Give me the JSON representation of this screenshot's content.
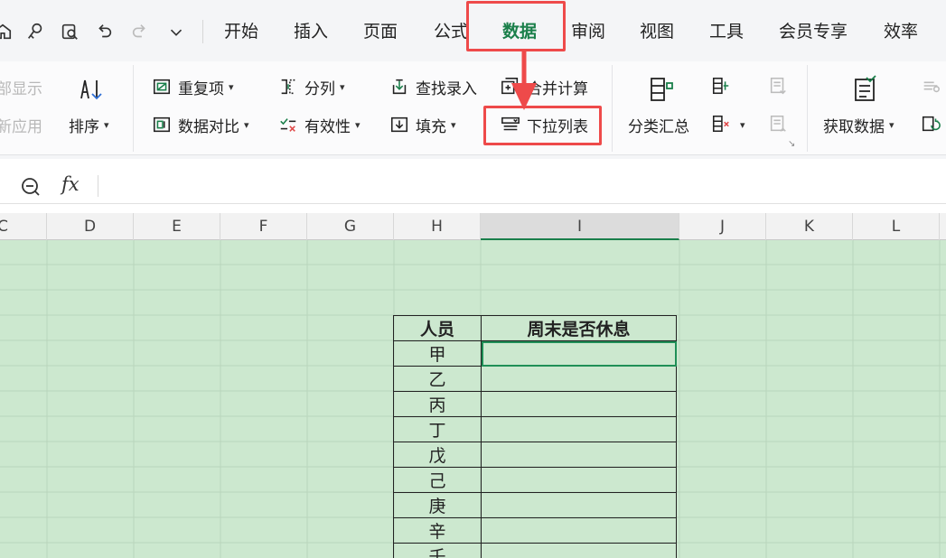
{
  "quick_access": [
    "home-icon",
    "brush-icon",
    "print-preview-icon",
    "undo-icon",
    "redo-icon",
    "chevron-down-icon"
  ],
  "tabs": [
    {
      "label": "开始",
      "active": false
    },
    {
      "label": "插入",
      "active": false
    },
    {
      "label": "页面",
      "active": false
    },
    {
      "label": "公式",
      "active": false
    },
    {
      "label": "数据",
      "active": true
    },
    {
      "label": "审阅",
      "active": false
    },
    {
      "label": "视图",
      "active": false
    },
    {
      "label": "工具",
      "active": false
    },
    {
      "label": "会员专享",
      "active": false
    },
    {
      "label": "效率",
      "active": false
    }
  ],
  "ribbon": {
    "show_all": "部显示",
    "reapply": "新应用",
    "sort": "排序",
    "duplicates": "重复项",
    "compare": "数据对比",
    "split": "分列",
    "validity": "有效性",
    "lookup_entry": "查找录入",
    "fill": "填充",
    "merge_calc": "合并计算",
    "dropdown_list": "下拉列表",
    "subtotal": "分类汇总",
    "get_data": "获取数据"
  },
  "formula_bar": {
    "fx": "fx",
    "value": ""
  },
  "columns": [
    {
      "label": "C",
      "selected": false
    },
    {
      "label": "D",
      "selected": false
    },
    {
      "label": "E",
      "selected": false
    },
    {
      "label": "F",
      "selected": false
    },
    {
      "label": "G",
      "selected": false
    },
    {
      "label": "H",
      "selected": false
    },
    {
      "label": "I",
      "selected": true
    },
    {
      "label": "J",
      "selected": false
    },
    {
      "label": "K",
      "selected": false
    },
    {
      "label": "L",
      "selected": false
    }
  ],
  "table": {
    "headers": [
      "人员",
      "周末是否休息"
    ],
    "rows": [
      {
        "name": "甲",
        "value": ""
      },
      {
        "name": "乙",
        "value": ""
      },
      {
        "name": "丙",
        "value": ""
      },
      {
        "name": "丁",
        "value": ""
      },
      {
        "name": "戊",
        "value": ""
      },
      {
        "name": "己",
        "value": ""
      },
      {
        "name": "庚",
        "value": ""
      },
      {
        "name": "辛",
        "value": ""
      },
      {
        "name": "壬",
        "value": ""
      }
    ]
  },
  "colors": {
    "accent": "#1a7f4a",
    "sheet_bg": "#cce8cf",
    "highlight": "#ee4a4a"
  }
}
